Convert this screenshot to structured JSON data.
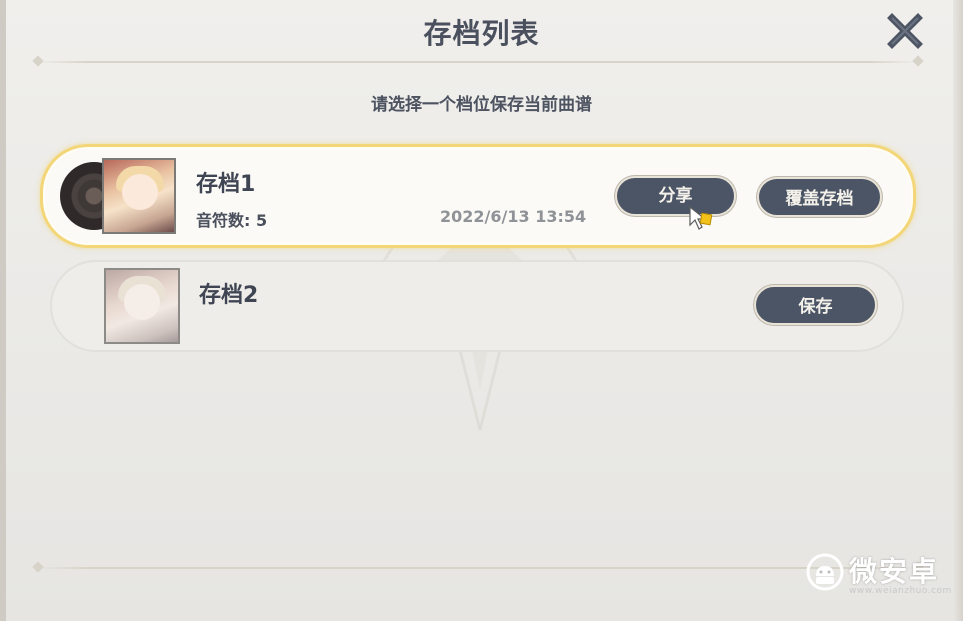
{
  "dialog": {
    "title": "存档列表",
    "subtitle": "请选择一个档位保存当前曲谱"
  },
  "slots": [
    {
      "name": "存档1",
      "notes_label": "音符数: 5",
      "timestamp": "2022/6/13 13:54",
      "share_label": "分享",
      "overwrite_label": "覆盖存档"
    },
    {
      "name": "存档2",
      "save_label": "保存"
    }
  ],
  "watermark": {
    "name": "微安卓",
    "url": "www.weianzhuo.com"
  },
  "icons": {
    "close": "close-icon",
    "cursor": "cursor-pointer-icon",
    "record": "vinyl-record-icon",
    "brand": "android-logo-icon"
  },
  "colors": {
    "accent_gold": "#f2d678",
    "button_bg": "#4c5566",
    "title_text": "#4a505d"
  }
}
